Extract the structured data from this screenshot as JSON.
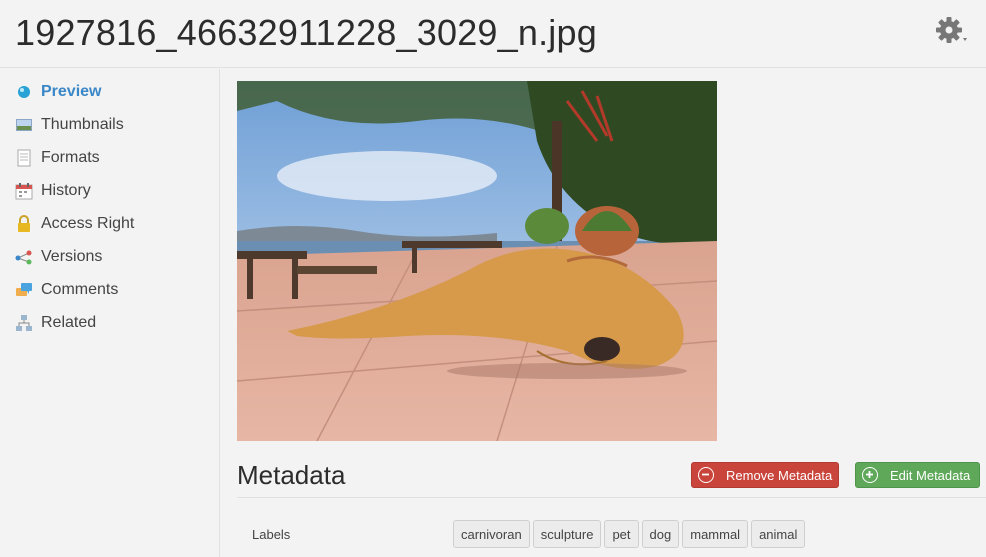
{
  "header": {
    "title": "1927816_46632911228_3029_n.jpg"
  },
  "sidebar": {
    "items": [
      {
        "label": "Preview",
        "icon": "preview-icon",
        "active": true
      },
      {
        "label": "Thumbnails",
        "icon": "thumbnails-icon"
      },
      {
        "label": "Formats",
        "icon": "formats-icon"
      },
      {
        "label": "History",
        "icon": "calendar-icon"
      },
      {
        "label": "Access Right",
        "icon": "lock-icon"
      },
      {
        "label": "Versions",
        "icon": "versions-icon"
      },
      {
        "label": "Comments",
        "icon": "comments-icon"
      },
      {
        "label": "Related",
        "icon": "related-icon"
      }
    ]
  },
  "main": {
    "metadata_title": "Metadata",
    "remove_label": "Remove Metadata",
    "edit_label": "Edit Metadata",
    "labels_caption": "Labels",
    "tags": [
      "carnivoran",
      "sculpture",
      "pet",
      "dog",
      "mammal",
      "animal"
    ]
  },
  "colors": {
    "accent": "#3a87c8",
    "remove": "#c9443a",
    "edit": "#5fa85a"
  }
}
